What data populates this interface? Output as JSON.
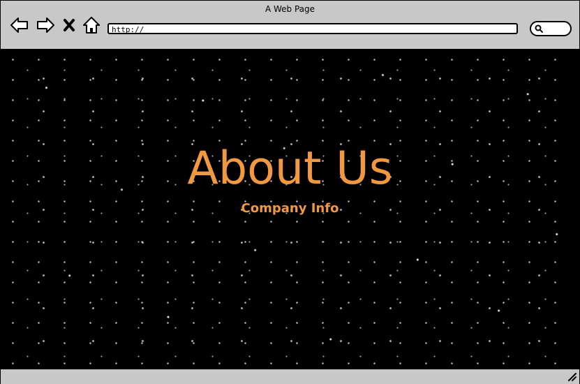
{
  "browser": {
    "title": "A Web Page",
    "url": "http://",
    "search_placeholder": ""
  },
  "page": {
    "heading": "About Us",
    "subheading": "Company Info"
  },
  "colors": {
    "accent": "#f2983f",
    "chrome": "#c8c8c8",
    "background": "#000000"
  },
  "icons": {
    "back": "arrow-left-icon",
    "forward": "arrow-right-icon",
    "close": "close-icon",
    "home": "home-icon",
    "search": "search-icon",
    "resize": "resize-icon"
  }
}
